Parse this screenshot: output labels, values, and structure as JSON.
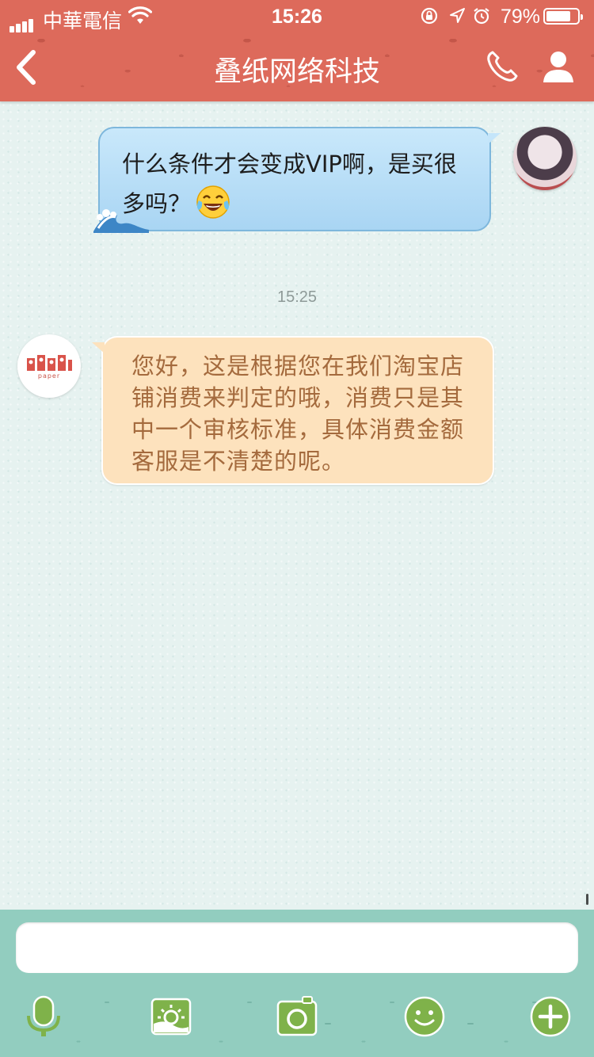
{
  "status_bar": {
    "carrier": "中華電信",
    "time": "15:26",
    "battery_percent": "79%",
    "battery_level": 0.79
  },
  "header": {
    "title": "叠纸网络科技",
    "back_icon": "chevron-left-icon",
    "call_icon": "phone-icon",
    "profile_icon": "person-icon"
  },
  "messages": [
    {
      "direction": "outgoing",
      "text": "什么条件才会变成VIP啊，是买很多吗？",
      "emoji": "tears-of-joy-emoji"
    },
    {
      "type": "timestamp",
      "text": "15:25"
    },
    {
      "direction": "incoming",
      "avatar_text": "paper",
      "text": "您好，这是根据您在我们淘宝店铺消费来判定的哦，消费只是其中一个审核标准，具体消费金额客服是不清楚的呢。"
    }
  ],
  "composer": {
    "input_value": "",
    "placeholder": ""
  },
  "toolbar": {
    "icons": [
      "microphone-icon",
      "image-icon",
      "camera-icon",
      "emoji-icon",
      "plus-icon"
    ]
  },
  "colors": {
    "header": "#dd6a5b",
    "outgoing_bubble": "#b8ddf6",
    "incoming_bubble": "#fde2bd",
    "incoming_text": "#a46a3d",
    "bottom_bar": "#92cdbf",
    "tool_green": "#7fb24a"
  }
}
